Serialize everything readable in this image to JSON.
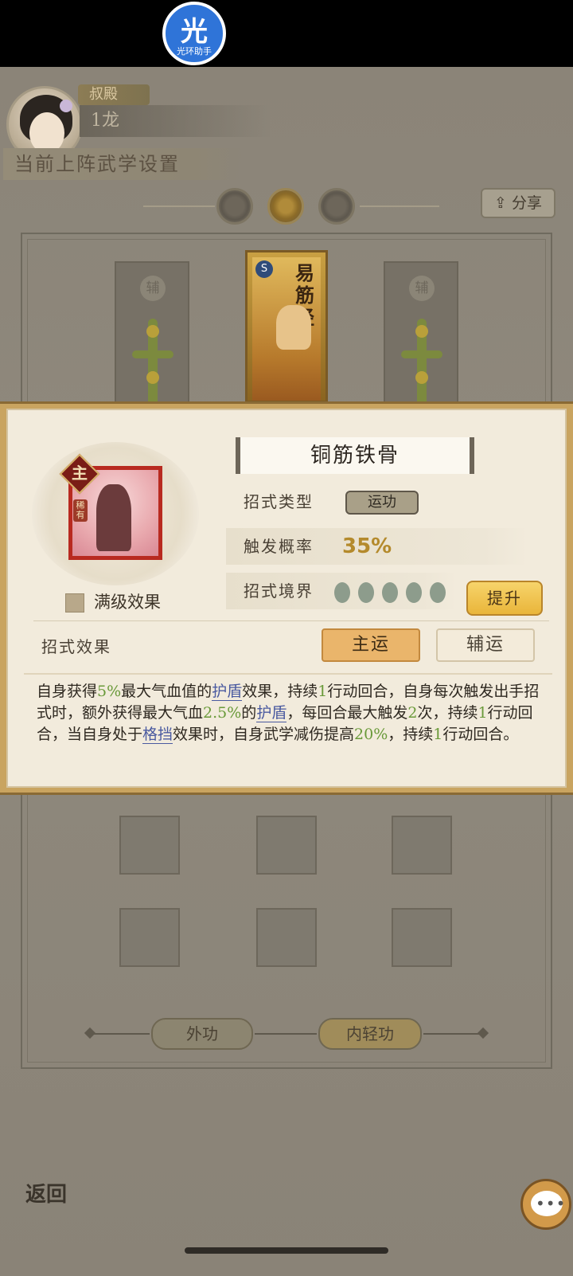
{
  "header": {
    "rank_tag": "叔殿",
    "player_name": "1龙"
  },
  "badge": {
    "glyph": "光",
    "label": "光环助手"
  },
  "section_title": "当前上阵武学设置",
  "share_label": "分享",
  "board": {
    "side_slot_label": "辅",
    "main_card": {
      "grade": "S",
      "name": "易筋经"
    }
  },
  "bottom_tabs": {
    "outer": "外功",
    "inner": "内轻功"
  },
  "back_label": "返回",
  "popup": {
    "skill_name": "铜筋铁骨",
    "main_badge": "主",
    "rarity": "稀有",
    "max_level_label": "满级效果",
    "type_label": "招式类型",
    "type_value": "运功",
    "rate_label": "触发概率",
    "rate_value": "35%",
    "realm_label": "招式境界",
    "realm_level": 5,
    "upgrade_label": "提升",
    "effect_label": "招式效果",
    "toggle_main": "主运",
    "toggle_aux": "辅运",
    "desc": {
      "p1": "自身获得",
      "v1": "5%",
      "p2": "最大气血值的",
      "k1": "护盾",
      "p3": "效果，持续",
      "v2": "1",
      "p4": "行动回合，自身每次触发出手招式时，额外获得最大气血",
      "v3": "2.5%",
      "p5": "的",
      "k2": "护盾",
      "p6": "，每回合最大触发",
      "v4": "2",
      "p7": "次，持续",
      "v5": "1",
      "p8": "行动回合，当自身处于",
      "k3": "格挡",
      "p9": "效果时，自身武学减伤提高",
      "v6": "20%",
      "p10": "，持续",
      "v7": "1",
      "p11": "行动回合。"
    }
  },
  "colors": {
    "highlight_green": "#6a9a3a",
    "keyword_blue": "#4a5aa0",
    "accent_gold": "#e9b53a"
  }
}
